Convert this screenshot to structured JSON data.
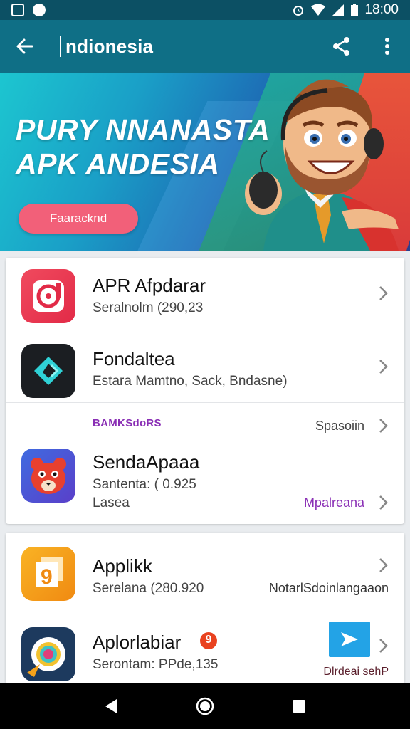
{
  "status_bar": {
    "time": "18:00",
    "icons": [
      "photo-icon",
      "play-store-icon",
      "alarm-icon",
      "wifi-icon",
      "signal-icon",
      "battery-icon"
    ]
  },
  "app_bar": {
    "title": "ndionesia",
    "back_icon": "arrow-left-icon",
    "share_icon": "share-icon",
    "menu_icon": "more-vert-icon"
  },
  "banner": {
    "headline_line1": "PURY NNANASTA",
    "headline_line2": "APK ANDESIA",
    "button_label": "Faaracknd"
  },
  "apps_group1": [
    {
      "name": "APR Afpdarar",
      "sub": "Seralnolm (290,23",
      "icon": "music-disc-icon",
      "icon_color": "#ee3b50"
    },
    {
      "name": "Fondaltea",
      "sub": "Estara Mamtno, Sack, Bndasne)",
      "icon": "diamond-arrow-icon",
      "icon_color": "#1b1e22"
    }
  ],
  "section": {
    "label": "BAMKSdoRS",
    "right_label": "Spasoiin"
  },
  "app3": {
    "name": "SendaApaaa",
    "sub": "Santenta: ( 0.925",
    "sub2": "Lasea",
    "right_label": "Mpalreana",
    "icon": "bear-face-icon",
    "icon_color": "#4463d8"
  },
  "apps_group2": [
    {
      "name": "Applikk",
      "sub": "Serelana (280.920",
      "right_label": "NotarlSdoinlangaaon",
      "icon": "notepad-icon",
      "icon_color": "#f6a21a"
    },
    {
      "name": "Aplorlabiar",
      "sub": "Serontam: PPde,135",
      "right_label": "Dlrdeai sehP",
      "badge": "9",
      "icon": "camera-lens-icon",
      "icon_color": "#1d3a5e"
    }
  ],
  "nav_bar": {
    "icons": [
      "nav-back-icon",
      "nav-home-icon",
      "nav-recents-icon"
    ]
  },
  "colors": {
    "app_bar": "#0f6f86",
    "status_bar": "#0c5064",
    "accent_purple": "#8a2fb5",
    "banner_button": "#f26079"
  }
}
